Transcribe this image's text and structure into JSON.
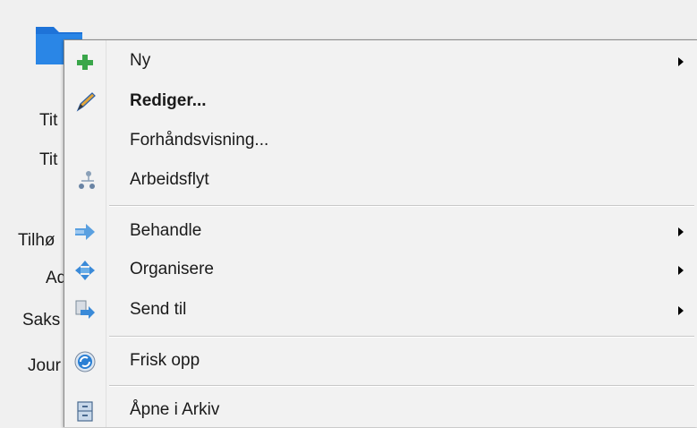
{
  "background": {
    "labels": [
      "Tit",
      "Tit",
      "Tilhø",
      "Ad",
      "Saks",
      "Jour"
    ]
  },
  "menu": {
    "items": [
      {
        "label": "Ny",
        "icon": "plus-icon",
        "submenu": true,
        "bold": false
      },
      {
        "label": "Rediger...",
        "icon": "pencil-icon",
        "submenu": false,
        "bold": true
      },
      {
        "label": "Forhåndsvisning...",
        "icon": "",
        "submenu": false,
        "bold": false
      },
      {
        "label": "Arbeidsflyt",
        "icon": "workflow-icon",
        "submenu": false,
        "bold": false
      },
      {
        "label": "Behandle",
        "icon": "process-arrow-icon",
        "submenu": true,
        "bold": false
      },
      {
        "label": "Organisere",
        "icon": "move-icon",
        "submenu": true,
        "bold": false
      },
      {
        "label": "Send til",
        "icon": "send-to-icon",
        "submenu": true,
        "bold": false
      },
      {
        "label": "Frisk opp",
        "icon": "refresh-icon",
        "submenu": false,
        "bold": false
      },
      {
        "label": "Åpne i Arkiv",
        "icon": "archive-cabinet-icon",
        "submenu": false,
        "bold": false
      }
    ]
  },
  "colors": {
    "folder": "#1e73d8",
    "plus": "#3aa64a",
    "accent_blue": "#2a7fd4"
  }
}
